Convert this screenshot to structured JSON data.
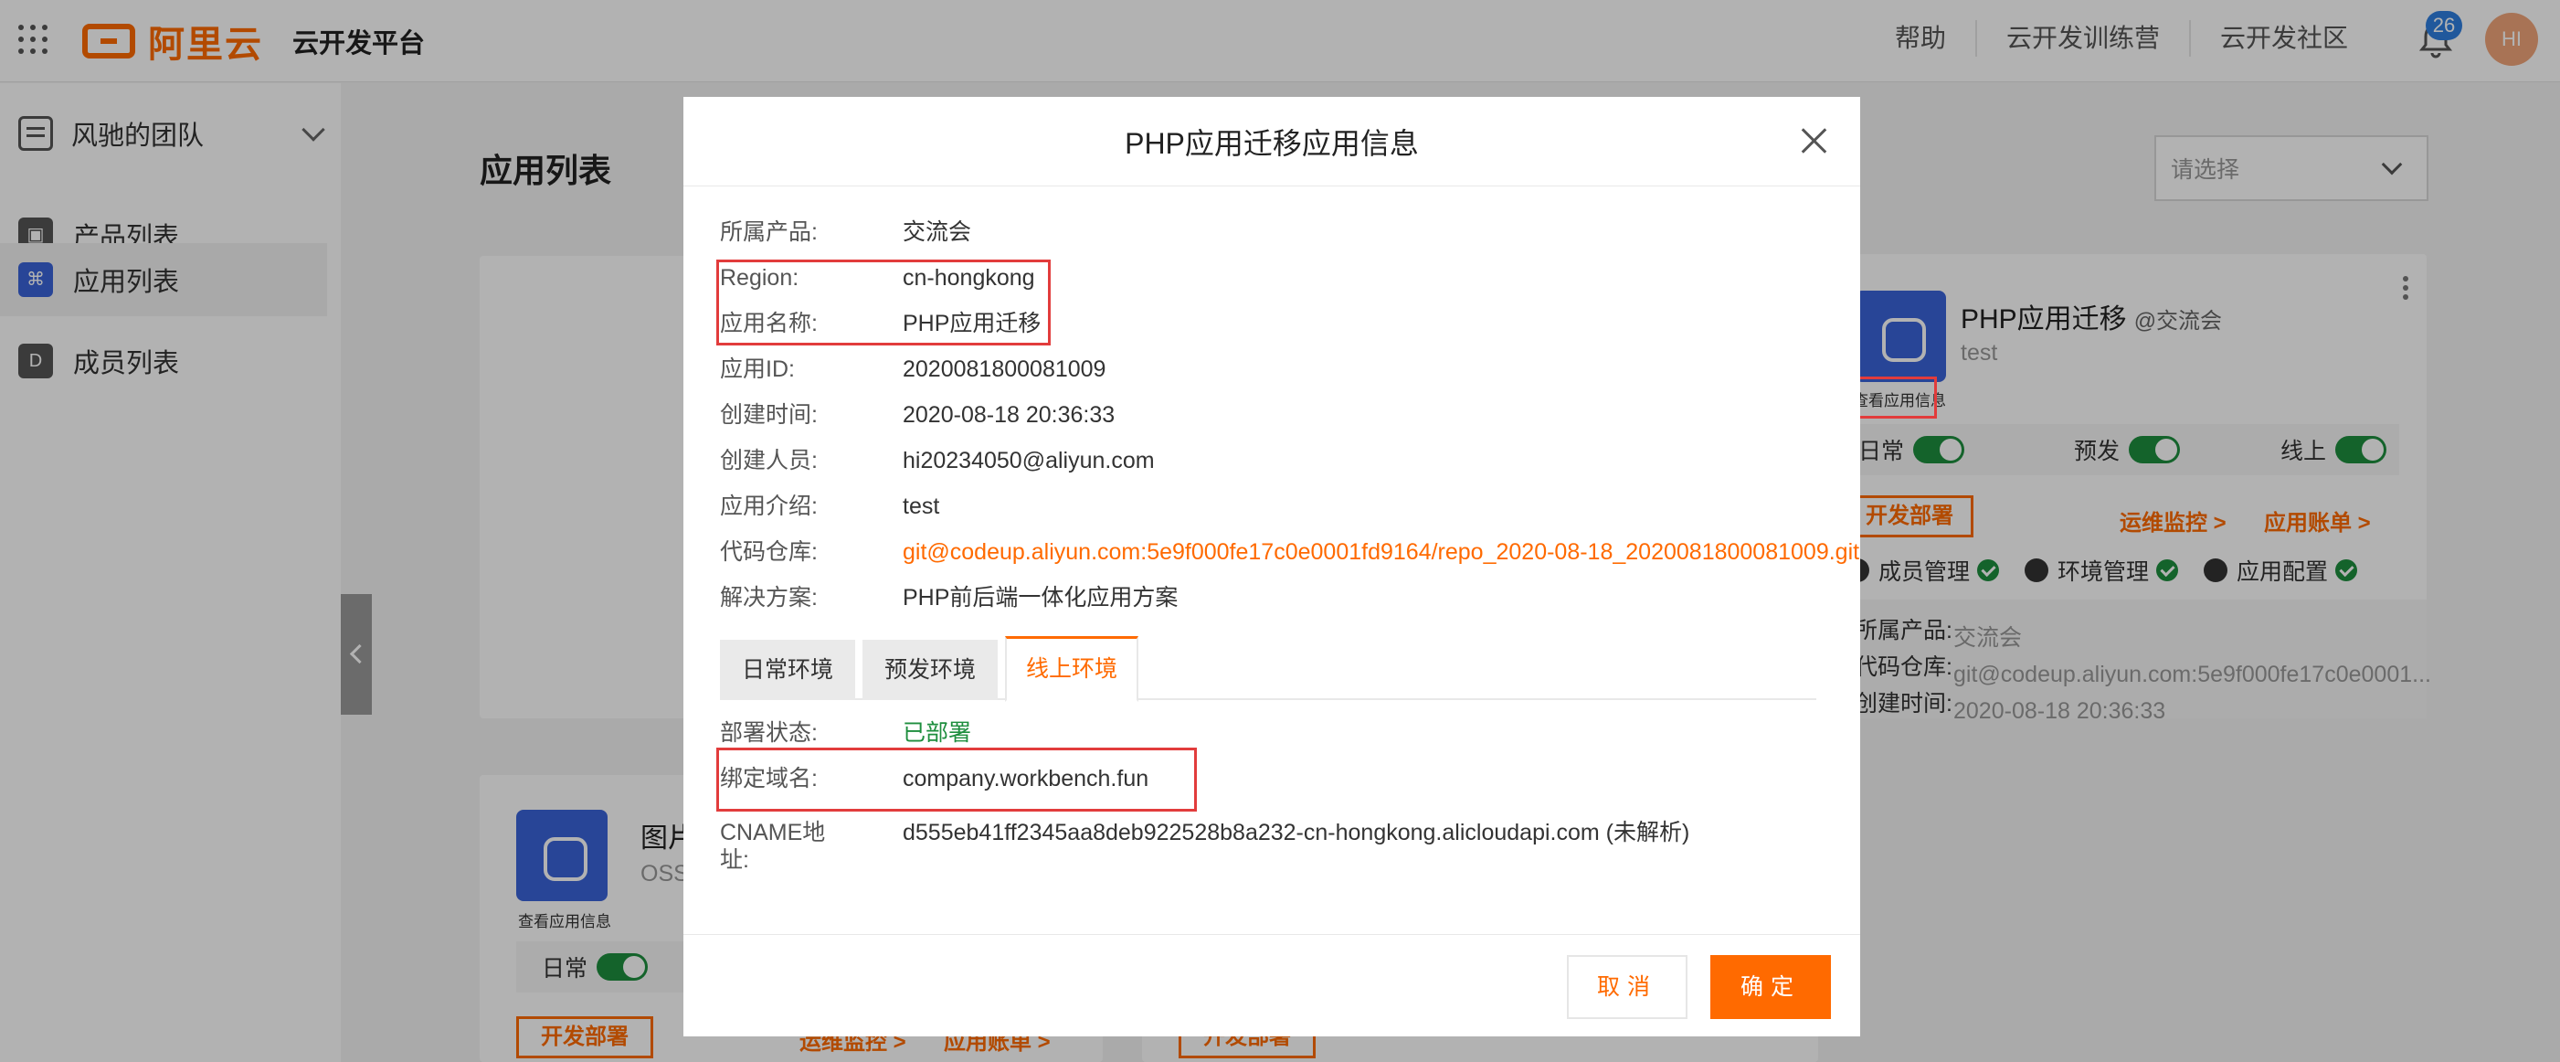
{
  "header": {
    "logo_text": "阿里云",
    "platform": "云开发平台",
    "links": [
      "帮助",
      "云开发训练营",
      "云开发社区"
    ],
    "notification_count": "26",
    "avatar": "HI"
  },
  "sidebar": {
    "team": "风驰的团队",
    "items": [
      {
        "label": "产品列表",
        "active": false
      },
      {
        "label": "应用列表",
        "active": true
      },
      {
        "label": "成员列表",
        "active": false
      }
    ]
  },
  "main": {
    "title": "应用列表",
    "select_placeholder": "请选择",
    "card": {
      "title": "PHP应用迁移",
      "team": "@交流会",
      "desc": "test",
      "view_info": "查看应用信息",
      "envs": [
        "日常",
        "预发",
        "线上"
      ],
      "dev_button": "开发部署",
      "monitor_link": "运维监控 >",
      "bill_link": "应用账单 >",
      "mgmt": [
        "成员管理",
        "环境管理",
        "应用配置"
      ],
      "info": [
        {
          "k": "所属产品:",
          "v": "交流会"
        },
        {
          "k": "代码仓库:",
          "v": "git@codeup.aliyun.com:5e9f000fe17c0e0001..."
        },
        {
          "k": "创建时间:",
          "v": "2020-08-18 20:36:33"
        }
      ]
    },
    "card2": {
      "title": "图片",
      "sub": "OSS",
      "view_info": "查看应用信息",
      "env": "日常",
      "dev_button": "开发部署",
      "monitor_link": "运维监控 >",
      "bill_link": "应用账单 >"
    },
    "card3": {
      "dev_button": "开发部署"
    }
  },
  "modal": {
    "title": "PHP应用迁移应用信息",
    "fields": [
      {
        "k": "所属产品:",
        "v": "交流会"
      },
      {
        "k": "Region:",
        "v": "cn-hongkong"
      },
      {
        "k": "应用名称:",
        "v": "PHP应用迁移"
      },
      {
        "k": "应用ID:",
        "v": "2020081800081009"
      },
      {
        "k": "创建时间:",
        "v": "2020-08-18 20:36:33"
      },
      {
        "k": "创建人员:",
        "v": "hi20234050@aliyun.com"
      },
      {
        "k": "应用介绍:",
        "v": "test"
      },
      {
        "k": "代码仓库:",
        "v": "git@codeup.aliyun.com:5e9f000fe17c0e0001fd9164/repo_2020-08-18_2020081800081009.git"
      },
      {
        "k": "解决方案:",
        "v": "PHP前后端一体化应用方案"
      }
    ],
    "tabs": [
      "日常环境",
      "预发环境",
      "线上环境"
    ],
    "env_fields": [
      {
        "k": "部署状态:",
        "v": "已部署"
      },
      {
        "k": "绑定域名:",
        "v": "company.workbench.fun"
      },
      {
        "k1": "CNAME地",
        "k2": "址:",
        "v": "d555eb41ff2345aa8deb922528b8a232-cn-hongkong.alicloudapi.com (未解析)"
      }
    ],
    "cancel": "取消",
    "ok": "确定"
  },
  "colors": {
    "accent": "#ff6a00",
    "success": "#1e8e3e",
    "brand_blue": "#3a63d8",
    "highlight": "#e23c3c"
  }
}
